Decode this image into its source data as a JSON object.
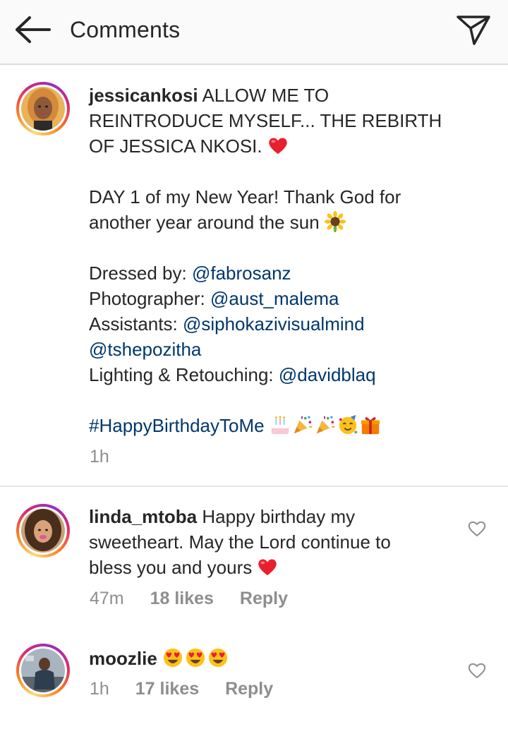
{
  "header": {
    "title": "Comments",
    "back_icon": "arrow-left-icon",
    "share_icon": "paper-plane-icon"
  },
  "post": {
    "username": "jessicankosi",
    "caption_line1_text": " ALLOW ME TO",
    "caption_line2": "REINTRODUCE MYSELF... THE REBIRTH",
    "caption_line3_text": "OF JESSICA NKOSI. ",
    "caption_line4": "DAY 1 of my New Year! Thank God for",
    "caption_line5_text": "another year around the sun ",
    "credit1_label": "Dressed by: ",
    "credit1_mention": "@fabrosanz",
    "credit2_label": "Photographer: ",
    "credit2_mention": "@aust_malema",
    "credit3_label": "Assistants: ",
    "credit3_mention": "@siphokazivisualmind",
    "credit3_mention2": "@tshepozitha",
    "credit4_label": "Lighting & Retouching: ",
    "credit4_mention": "@davidblaq",
    "hashtag": "#HappyBirthdayToMe",
    "time": "1h",
    "emojis": [
      "red-heart",
      "sunflower",
      "birthday-cake",
      "party-popper",
      "partying-face",
      "wrapped-gift"
    ]
  },
  "comments": [
    {
      "username": "linda_mtoba",
      "line1_text": " Happy birthday my",
      "line2": "sweetheart. May the Lord continue to",
      "line3_text": "bless you and yours ",
      "time": "47m",
      "likes": "18 likes",
      "reply": "Reply"
    },
    {
      "username": "moozlie",
      "emojis": [
        "heart-eyes-face",
        "heart-eyes-face",
        "heart-eyes-face"
      ],
      "time": "1h",
      "likes": "17 likes",
      "reply": "Reply"
    }
  ],
  "colors": {
    "text": "#262626",
    "link": "#00376b",
    "meta": "#8e8e8e",
    "header_bg": "#fafafa",
    "heart_red": "#ed2f3c"
  }
}
